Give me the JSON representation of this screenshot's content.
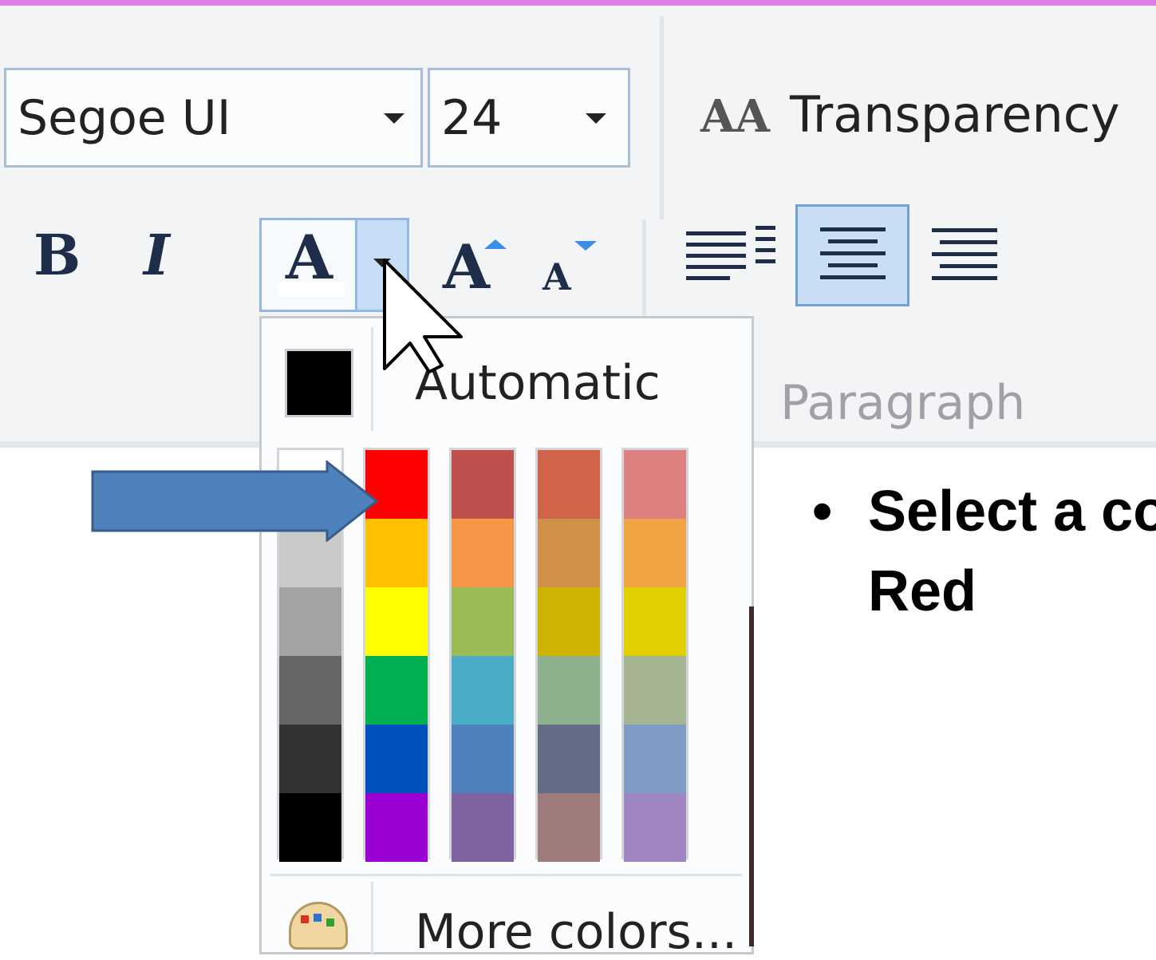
{
  "ribbon": {
    "font_name": "Segoe UI",
    "font_size": "24",
    "bold_label": "B",
    "italic_label": "I",
    "font_color_glyph": "A",
    "grow_glyph": "A",
    "shrink_glyph": "A",
    "transparency_icon_glyph": "AA",
    "transparency_label": "Transparency",
    "paragraph_group_label": "Paragraph"
  },
  "color_menu": {
    "automatic_label": "Automatic",
    "automatic_color": "#000000",
    "more_colors_label": "More colors...",
    "selected_color": "#ff0000",
    "columns": [
      [
        "#ffffff",
        "#c9c9c9",
        "#a3a3a3",
        "#666666",
        "#333333",
        "#000000"
      ],
      [
        "#ff0000",
        "#ffc000",
        "#ffff00",
        "#00b050",
        "#0050be",
        "#9b00d3"
      ],
      [
        "#c0504d",
        "#f79646",
        "#9bbb59",
        "#4bacc6",
        "#4f81bd",
        "#8064a2"
      ],
      [
        "#d16349",
        "#d19049",
        "#ccb400",
        "#8fb08c",
        "#646b86",
        "#9e7c7c"
      ],
      [
        "#dd8080",
        "#f2a444",
        "#e0d000",
        "#a5b592",
        "#7f9cc4",
        "#9f86c0"
      ]
    ]
  },
  "slide": {
    "bullet": "•",
    "line1": "Select a co",
    "line2": "Red"
  },
  "colors": {
    "accent_border": "#95b8e2",
    "arrow_fill": "#4f81bd"
  }
}
